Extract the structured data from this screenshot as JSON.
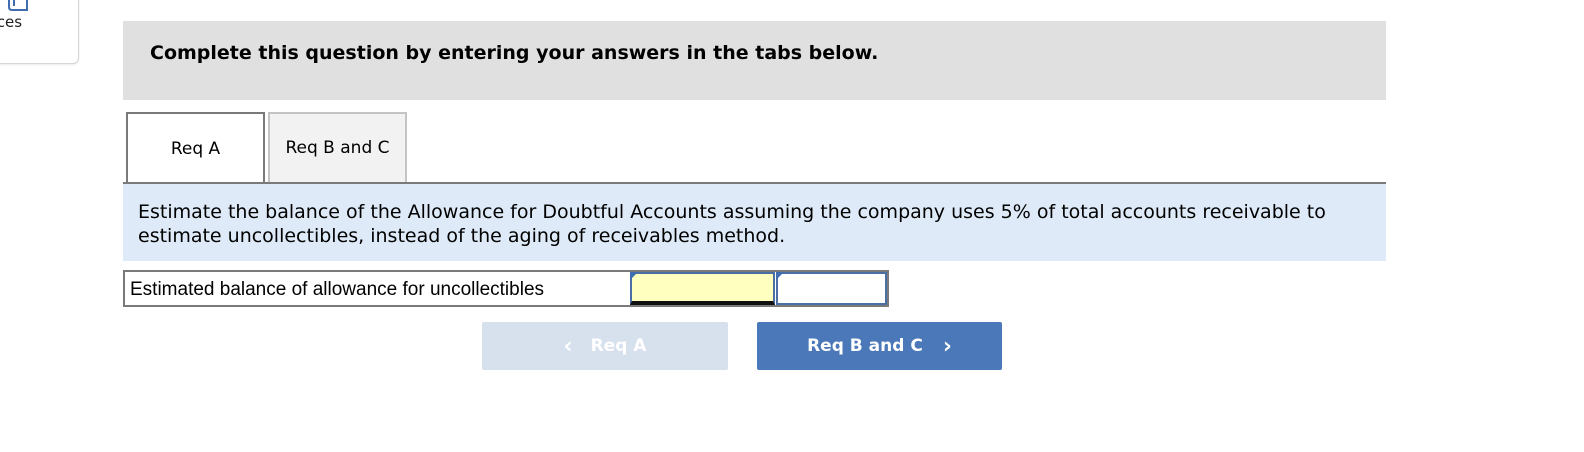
{
  "references": {
    "label": "erences"
  },
  "header": {
    "instruction": "Complete this question by entering your answers in the tabs below."
  },
  "tabs": [
    {
      "label": "Req A",
      "active": true
    },
    {
      "label": "Req B and C",
      "active": false
    }
  ],
  "instruction_text": "Estimate the balance of the Allowance for Doubtful Accounts assuming the company uses 5% of total accounts receivable to estimate uncollectibles, instead of the aging of receivables method.",
  "answer": {
    "label": "Estimated balance of allowance for uncollectibles",
    "value": "",
    "unit_value": ""
  },
  "nav": {
    "prev_label": "Req A",
    "next_label": "Req B and C",
    "prev_icon": "chevron-left-icon",
    "next_icon": "chevron-right-icon"
  },
  "colors": {
    "header_bg": "#e0e0e0",
    "instruction_bg": "#deeaf7",
    "input_highlight": "#ffffc0",
    "next_button": "#4a78b8",
    "prev_button_disabled": "#d7e1ee"
  }
}
